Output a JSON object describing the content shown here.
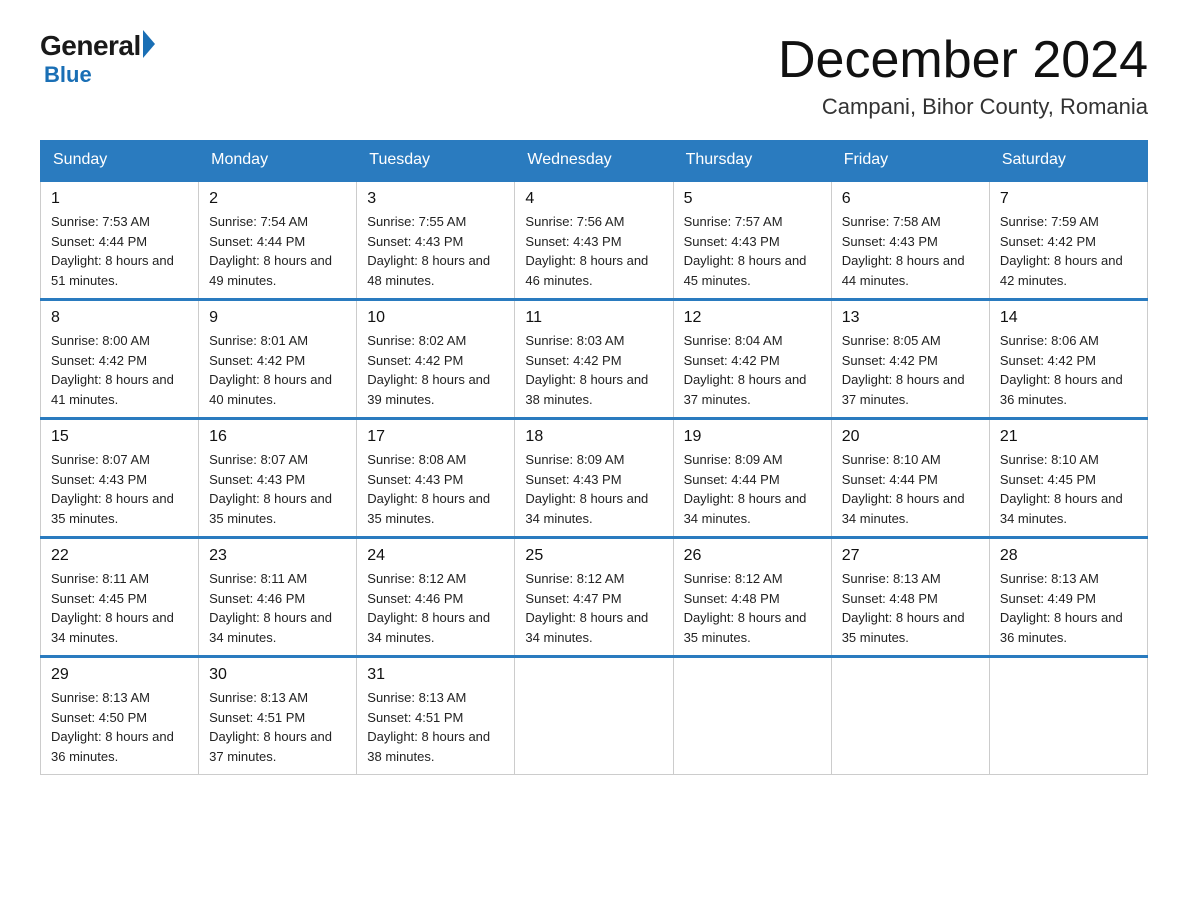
{
  "logo": {
    "general": "General",
    "triangle": "▶",
    "blue": "Blue"
  },
  "title": "December 2024",
  "location": "Campani, Bihor County, Romania",
  "weekdays": [
    "Sunday",
    "Monday",
    "Tuesday",
    "Wednesday",
    "Thursday",
    "Friday",
    "Saturday"
  ],
  "weeks": [
    [
      {
        "day": 1,
        "sunrise": "7:53 AM",
        "sunset": "4:44 PM",
        "daylight": "8 hours and 51 minutes."
      },
      {
        "day": 2,
        "sunrise": "7:54 AM",
        "sunset": "4:44 PM",
        "daylight": "8 hours and 49 minutes."
      },
      {
        "day": 3,
        "sunrise": "7:55 AM",
        "sunset": "4:43 PM",
        "daylight": "8 hours and 48 minutes."
      },
      {
        "day": 4,
        "sunrise": "7:56 AM",
        "sunset": "4:43 PM",
        "daylight": "8 hours and 46 minutes."
      },
      {
        "day": 5,
        "sunrise": "7:57 AM",
        "sunset": "4:43 PM",
        "daylight": "8 hours and 45 minutes."
      },
      {
        "day": 6,
        "sunrise": "7:58 AM",
        "sunset": "4:43 PM",
        "daylight": "8 hours and 44 minutes."
      },
      {
        "day": 7,
        "sunrise": "7:59 AM",
        "sunset": "4:42 PM",
        "daylight": "8 hours and 42 minutes."
      }
    ],
    [
      {
        "day": 8,
        "sunrise": "8:00 AM",
        "sunset": "4:42 PM",
        "daylight": "8 hours and 41 minutes."
      },
      {
        "day": 9,
        "sunrise": "8:01 AM",
        "sunset": "4:42 PM",
        "daylight": "8 hours and 40 minutes."
      },
      {
        "day": 10,
        "sunrise": "8:02 AM",
        "sunset": "4:42 PM",
        "daylight": "8 hours and 39 minutes."
      },
      {
        "day": 11,
        "sunrise": "8:03 AM",
        "sunset": "4:42 PM",
        "daylight": "8 hours and 38 minutes."
      },
      {
        "day": 12,
        "sunrise": "8:04 AM",
        "sunset": "4:42 PM",
        "daylight": "8 hours and 37 minutes."
      },
      {
        "day": 13,
        "sunrise": "8:05 AM",
        "sunset": "4:42 PM",
        "daylight": "8 hours and 37 minutes."
      },
      {
        "day": 14,
        "sunrise": "8:06 AM",
        "sunset": "4:42 PM",
        "daylight": "8 hours and 36 minutes."
      }
    ],
    [
      {
        "day": 15,
        "sunrise": "8:07 AM",
        "sunset": "4:43 PM",
        "daylight": "8 hours and 35 minutes."
      },
      {
        "day": 16,
        "sunrise": "8:07 AM",
        "sunset": "4:43 PM",
        "daylight": "8 hours and 35 minutes."
      },
      {
        "day": 17,
        "sunrise": "8:08 AM",
        "sunset": "4:43 PM",
        "daylight": "8 hours and 35 minutes."
      },
      {
        "day": 18,
        "sunrise": "8:09 AM",
        "sunset": "4:43 PM",
        "daylight": "8 hours and 34 minutes."
      },
      {
        "day": 19,
        "sunrise": "8:09 AM",
        "sunset": "4:44 PM",
        "daylight": "8 hours and 34 minutes."
      },
      {
        "day": 20,
        "sunrise": "8:10 AM",
        "sunset": "4:44 PM",
        "daylight": "8 hours and 34 minutes."
      },
      {
        "day": 21,
        "sunrise": "8:10 AM",
        "sunset": "4:45 PM",
        "daylight": "8 hours and 34 minutes."
      }
    ],
    [
      {
        "day": 22,
        "sunrise": "8:11 AM",
        "sunset": "4:45 PM",
        "daylight": "8 hours and 34 minutes."
      },
      {
        "day": 23,
        "sunrise": "8:11 AM",
        "sunset": "4:46 PM",
        "daylight": "8 hours and 34 minutes."
      },
      {
        "day": 24,
        "sunrise": "8:12 AM",
        "sunset": "4:46 PM",
        "daylight": "8 hours and 34 minutes."
      },
      {
        "day": 25,
        "sunrise": "8:12 AM",
        "sunset": "4:47 PM",
        "daylight": "8 hours and 34 minutes."
      },
      {
        "day": 26,
        "sunrise": "8:12 AM",
        "sunset": "4:48 PM",
        "daylight": "8 hours and 35 minutes."
      },
      {
        "day": 27,
        "sunrise": "8:13 AM",
        "sunset": "4:48 PM",
        "daylight": "8 hours and 35 minutes."
      },
      {
        "day": 28,
        "sunrise": "8:13 AM",
        "sunset": "4:49 PM",
        "daylight": "8 hours and 36 minutes."
      }
    ],
    [
      {
        "day": 29,
        "sunrise": "8:13 AM",
        "sunset": "4:50 PM",
        "daylight": "8 hours and 36 minutes."
      },
      {
        "day": 30,
        "sunrise": "8:13 AM",
        "sunset": "4:51 PM",
        "daylight": "8 hours and 37 minutes."
      },
      {
        "day": 31,
        "sunrise": "8:13 AM",
        "sunset": "4:51 PM",
        "daylight": "8 hours and 38 minutes."
      },
      null,
      null,
      null,
      null
    ]
  ]
}
